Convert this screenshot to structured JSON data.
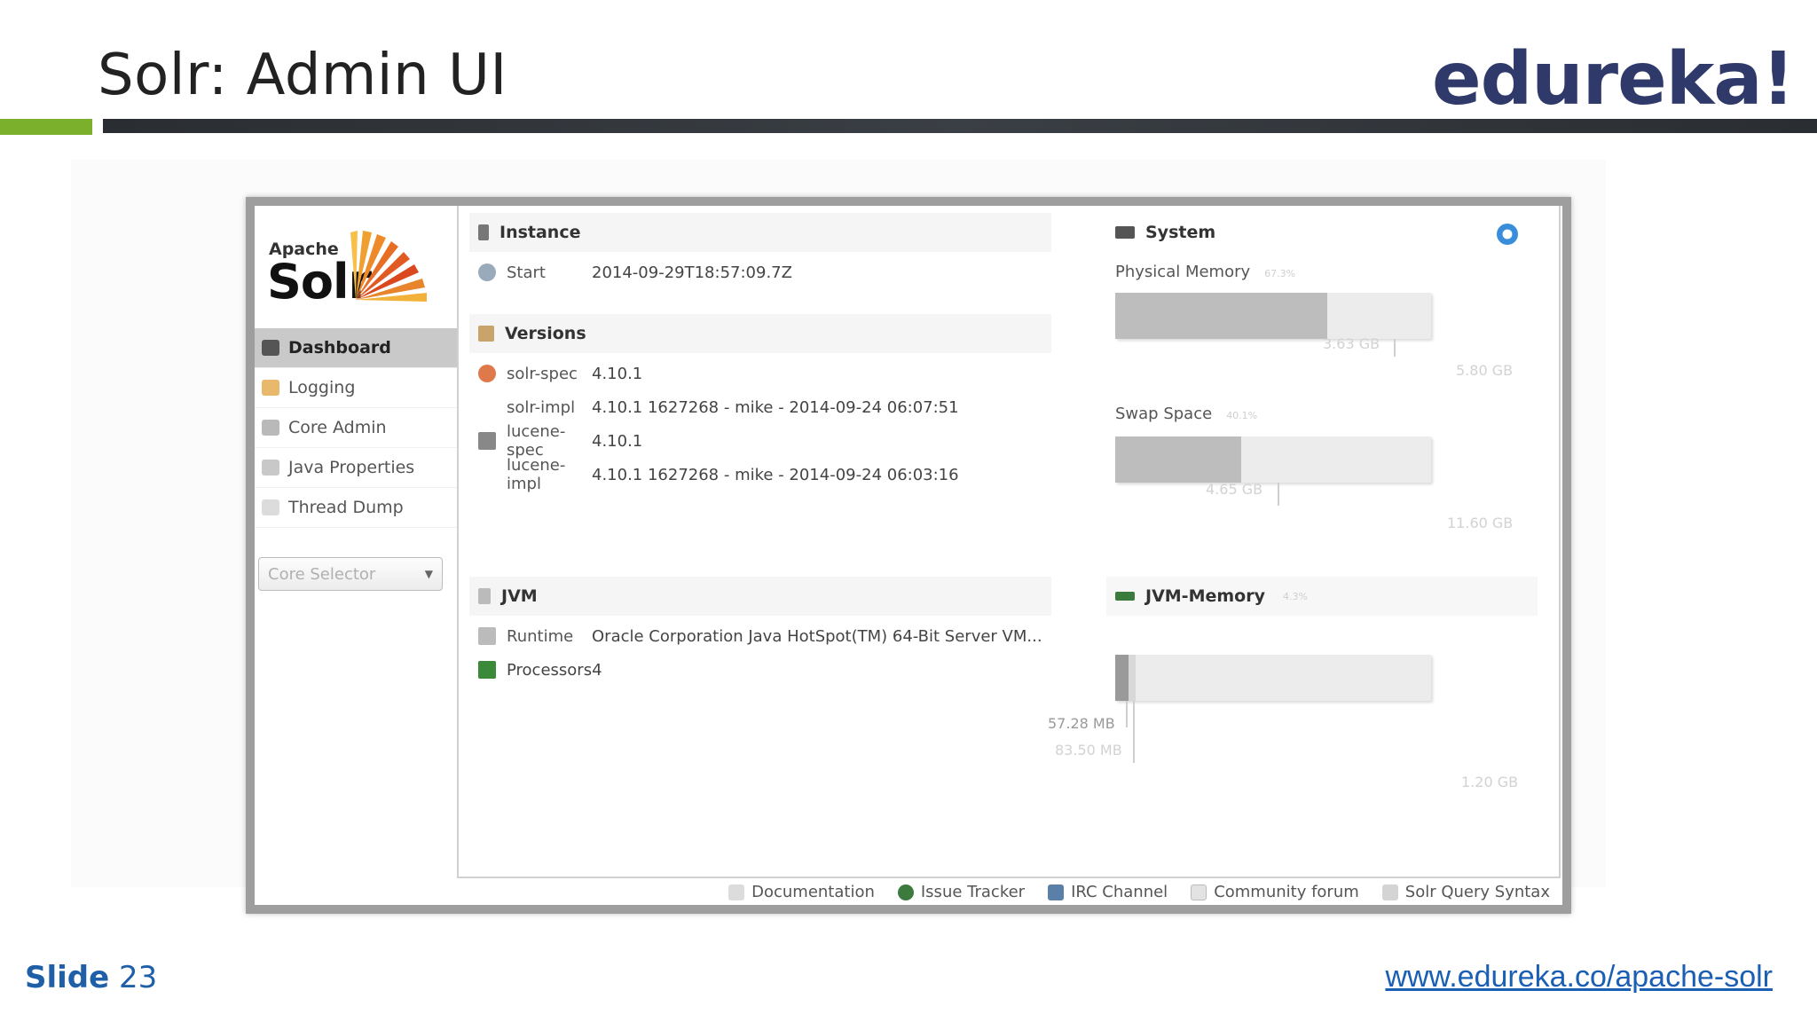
{
  "slide": {
    "title": "Solr: Admin UI",
    "logo": "edureka!",
    "footer_label": "Slide",
    "footer_number": "23",
    "url": "www.edureka.co/apache-solr"
  },
  "brand": {
    "apache": "Apache",
    "solr": "Solr"
  },
  "nav": {
    "items": [
      {
        "label": "Dashboard",
        "icon": "dashboard-icon"
      },
      {
        "label": "Logging",
        "icon": "logging-icon"
      },
      {
        "label": "Core Admin",
        "icon": "core-admin-icon"
      },
      {
        "label": "Java Properties",
        "icon": "java-properties-icon"
      },
      {
        "label": "Thread Dump",
        "icon": "thread-dump-icon"
      }
    ],
    "core_selector": "Core Selector"
  },
  "instance": {
    "title": "Instance",
    "start_label": "Start",
    "start_value": "2014-09-29T18:57:09.7Z"
  },
  "versions": {
    "title": "Versions",
    "rows": [
      {
        "key": "solr-spec",
        "value": "4.10.1"
      },
      {
        "key": "solr-impl",
        "value": "4.10.1 1627268 - mike - 2014-09-24 06:07:51"
      },
      {
        "key": "lucene-spec",
        "value": "4.10.1"
      },
      {
        "key": "lucene-impl",
        "value": "4.10.1 1627268 - mike - 2014-09-24 06:03:16"
      }
    ]
  },
  "jvm": {
    "title": "JVM",
    "runtime_label": "Runtime",
    "runtime_value": "Oracle Corporation Java HotSpot(TM) 64-Bit Server VM...",
    "processors_label": "Processors",
    "processors_value": "4"
  },
  "system": {
    "title": "System",
    "physical": {
      "label": "Physical Memory",
      "pct": "67.3%",
      "used": "3.63 GB",
      "total": "5.80 GB",
      "fill": 0.67
    },
    "swap": {
      "label": "Swap Space",
      "pct": "40.1%",
      "used": "4.65 GB",
      "total": "11.60 GB",
      "fill": 0.4
    }
  },
  "jvm_memory": {
    "title": "JVM-Memory",
    "pct": "4.3%",
    "used": "57.28 MB",
    "committed": "83.50 MB",
    "max": "1.20 GB",
    "fill_used": 0.043,
    "fill_committed": 0.065
  },
  "footer_links": [
    {
      "label": "Documentation",
      "icon": "document-icon"
    },
    {
      "label": "Issue Tracker",
      "icon": "bug-icon"
    },
    {
      "label": "IRC Channel",
      "icon": "people-icon"
    },
    {
      "label": "Community forum",
      "icon": "mail-icon"
    },
    {
      "label": "Solr Query Syntax",
      "icon": "query-syntax-icon"
    }
  ],
  "colors": {
    "accent_green": "#7ab02c",
    "logo_navy": "#2f3a6b",
    "link_blue": "#1a5fb4"
  }
}
